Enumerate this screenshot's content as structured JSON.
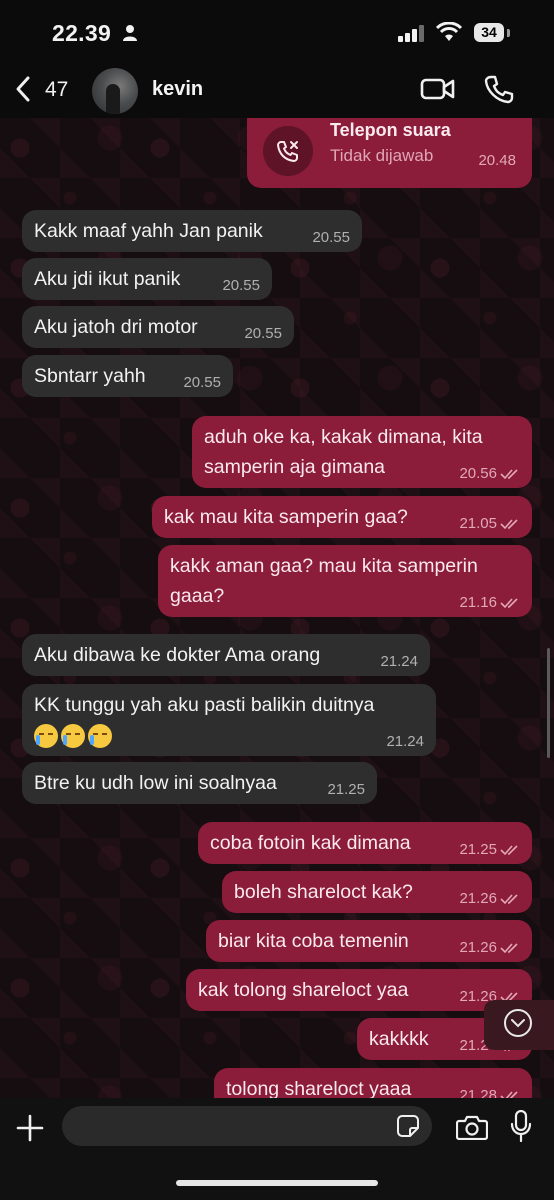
{
  "status_bar": {
    "time": "22.39",
    "battery": "34"
  },
  "header": {
    "back_count": "47",
    "contact_name": "kevin"
  },
  "call": {
    "title": "Telepon suara",
    "status": "Tidak dijawab",
    "time": "20.48"
  },
  "messages": [
    {
      "dir": "in",
      "text": "Kakk maaf yahh Jan panik",
      "time": "20.55"
    },
    {
      "dir": "in",
      "text": "Aku jdi ikut panik",
      "time": "20.55"
    },
    {
      "dir": "in",
      "text": "Aku jatoh dri motor",
      "time": "20.55"
    },
    {
      "dir": "in",
      "text": "Sbntarr yahh",
      "time": "20.55"
    },
    {
      "dir": "out",
      "text": "aduh oke ka, kakak dimana, kita samperin aja gimana",
      "time": "20.56"
    },
    {
      "dir": "out",
      "text": "kak mau kita samperin gaa?",
      "time": "21.05"
    },
    {
      "dir": "out",
      "text": "kakk aman gaa? mau kita samperin gaaa?",
      "time": "21.16"
    },
    {
      "dir": "in",
      "text": "Aku dibawa ke dokter Ama orang",
      "time": "21.24"
    },
    {
      "dir": "in",
      "text": "KK tunggu yah aku pasti balikin duitnya",
      "time": "21.24",
      "emoji": [
        "crying-face",
        "crying-face",
        "crying-face"
      ]
    },
    {
      "dir": "in",
      "text": "Btre ku udh low ini soalnyaa",
      "time": "21.25"
    },
    {
      "dir": "out",
      "text": "coba fotoin kak dimana",
      "time": "21.25"
    },
    {
      "dir": "out",
      "text": "boleh shareloct kak?",
      "time": "21.26"
    },
    {
      "dir": "out",
      "text": "biar kita coba temenin",
      "time": "21.26"
    },
    {
      "dir": "out",
      "text": "kak tolong shareloct yaa",
      "time": "21.26"
    },
    {
      "dir": "out",
      "text": "kakkkk",
      "time": "21.26"
    },
    {
      "dir": "out",
      "text": "tolong shareloct yaaa",
      "time": "21.28"
    }
  ],
  "colors": {
    "incoming_bubble": "#2e2e2e",
    "outgoing_bubble": "#8b1c3a",
    "background": "#150d10"
  },
  "icons": [
    "back-chevron-icon",
    "video-call-icon",
    "voice-call-icon",
    "phone-missed-icon",
    "double-check-icon",
    "scroll-down-icon",
    "plus-icon",
    "sticker-icon",
    "camera-icon",
    "mic-icon"
  ]
}
